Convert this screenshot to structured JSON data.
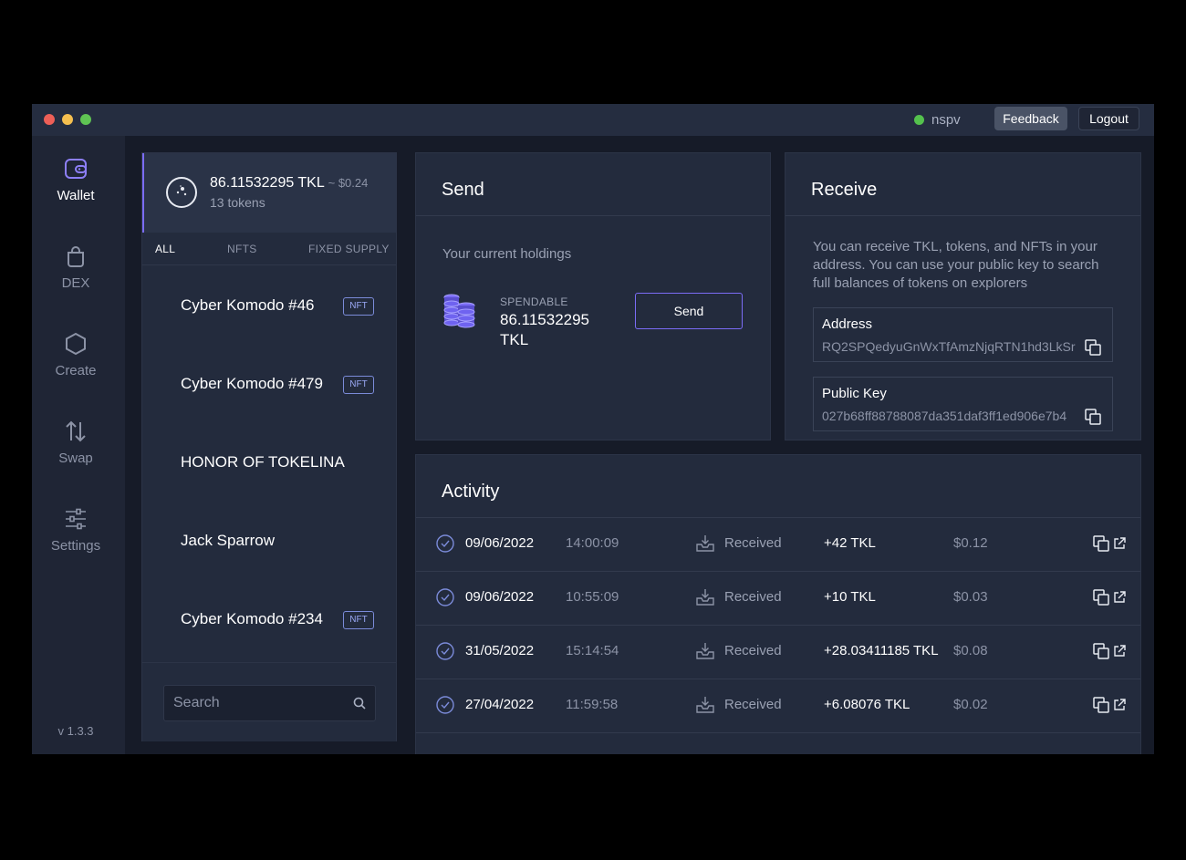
{
  "titlebar": {
    "network_status": "nspv",
    "feedback_label": "Feedback",
    "logout_label": "Logout"
  },
  "nav": {
    "items": [
      {
        "label": "Wallet",
        "icon": "wallet-icon"
      },
      {
        "label": "DEX",
        "icon": "bag-icon"
      },
      {
        "label": "Create",
        "icon": "hexagon-icon"
      },
      {
        "label": "Swap",
        "icon": "swap-arrows-icon"
      },
      {
        "label": "Settings",
        "icon": "sliders-icon"
      }
    ],
    "version": "v 1.3.3"
  },
  "tokens": {
    "balance": "86.11532295 TKL",
    "balance_usd": "~ $0.24",
    "count": "13 tokens",
    "tabs": [
      "ALL",
      "NFTS",
      "FIXED SUPPLY"
    ],
    "items": [
      {
        "name": "Cyber Komodo #46",
        "badge": "NFT"
      },
      {
        "name": "Cyber Komodo #479",
        "badge": "NFT"
      },
      {
        "name": "HONOR OF TOKELINA",
        "badge": ""
      },
      {
        "name": "Jack Sparrow",
        "badge": ""
      },
      {
        "name": "Cyber Komodo #234",
        "badge": "NFT"
      }
    ],
    "search_placeholder": "Search"
  },
  "send": {
    "title": "Send",
    "holdings_label": "Your current holdings",
    "spendable_label": "SPENDABLE",
    "spendable_value": "86.11532295 TKL",
    "button_label": "Send"
  },
  "receive": {
    "title": "Receive",
    "description": "You can receive TKL, tokens, and NFTs in your address. You can use your public key to search full balances of tokens on explorers",
    "address_label": "Address",
    "address_value": "RQ2SPQedyuGnWxTfAmzNjqRTN1hd3LkSr",
    "pubkey_label": "Public Key",
    "pubkey_value": "027b68ff88788087da351daf3ff1ed906e7b4"
  },
  "activity": {
    "title": "Activity",
    "rows": [
      {
        "date": "09/06/2022",
        "time": "14:00:09",
        "type": "Received",
        "amount": "+42 TKL",
        "usd": "$0.12"
      },
      {
        "date": "09/06/2022",
        "time": "10:55:09",
        "type": "Received",
        "amount": "+10 TKL",
        "usd": "$0.03"
      },
      {
        "date": "31/05/2022",
        "time": "15:14:54",
        "type": "Received",
        "amount": "+28.03411185 TKL",
        "usd": "$0.08"
      },
      {
        "date": "27/04/2022",
        "time": "11:59:58",
        "type": "Received",
        "amount": "+6.08076 TKL",
        "usd": "$0.02"
      }
    ]
  },
  "colors": {
    "accent": "#7b6cf6",
    "status_online": "#54c14d",
    "background": "#161b28",
    "panel": "#232b3d"
  }
}
